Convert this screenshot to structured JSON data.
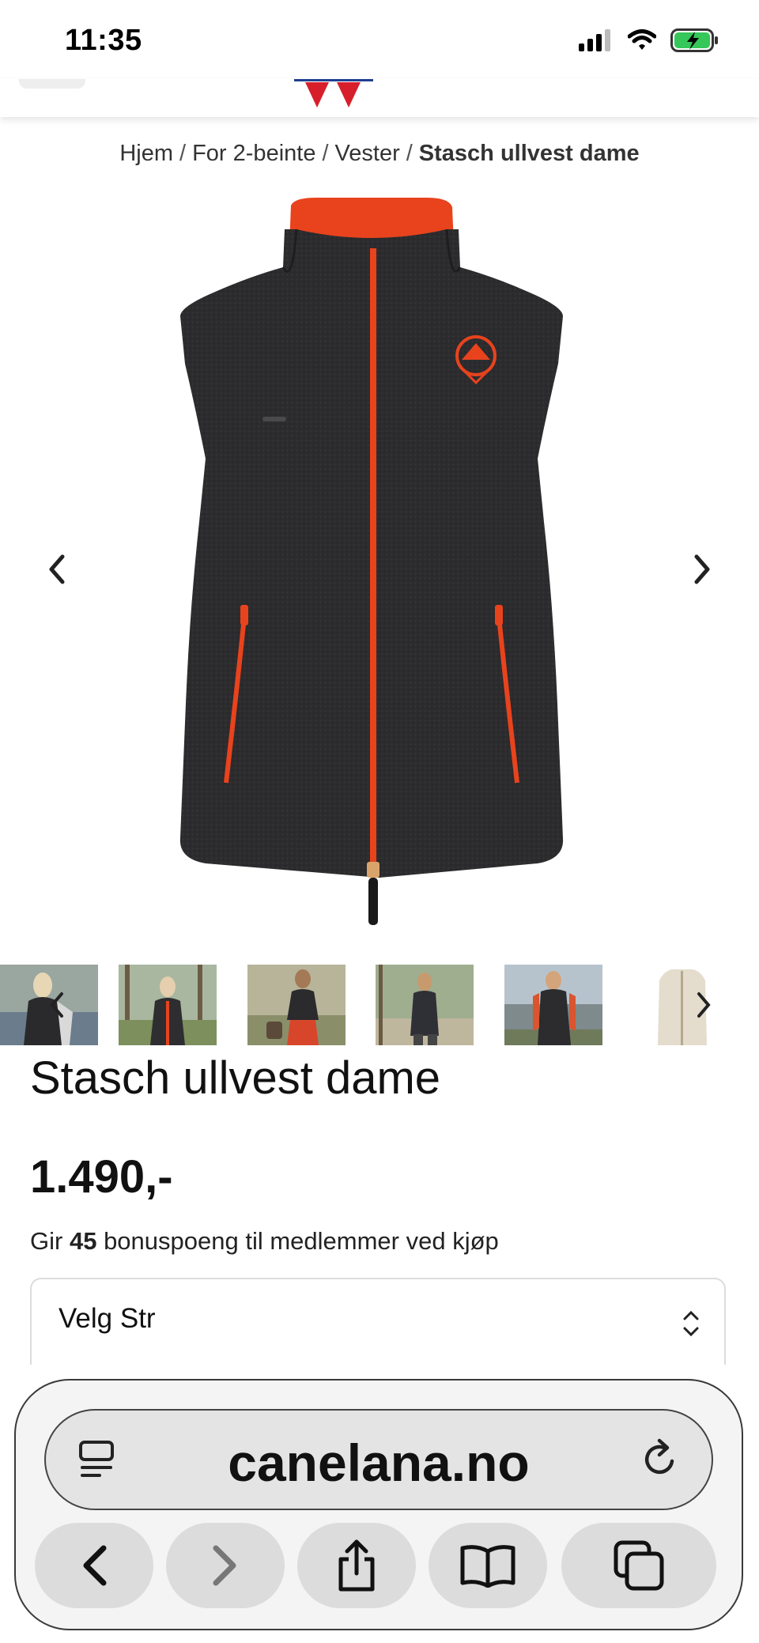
{
  "status_bar": {
    "time": "11:35"
  },
  "breadcrumb": {
    "items": [
      "Hjem",
      "For 2-beinte",
      "Vester"
    ],
    "separator": "/",
    "current": "Stasch ullvest dame"
  },
  "product": {
    "title": "Stasch ullvest dame",
    "price": "1.490,-",
    "bonus_prefix": "Gir",
    "bonus_points": "45",
    "bonus_suffix": "bonuspoeng til medlemmer ved kjøp",
    "size_select_label": "Velg Str"
  },
  "browser": {
    "url": "canelana.no"
  },
  "colors": {
    "vest": "#2c2b2d",
    "accent_orange": "#e8431d",
    "logo_red": "#d71f2b",
    "logo_blue": "#1f3f8f"
  },
  "icons": {
    "gallery_prev": "chevron-left-icon",
    "gallery_next": "chevron-right-icon",
    "select": "chevron-up-down-icon",
    "reader": "reader-icon",
    "reload": "reload-icon",
    "back": "back-icon",
    "forward": "forward-icon",
    "share": "share-icon",
    "bookmarks": "book-icon",
    "tabs": "tabs-icon"
  }
}
